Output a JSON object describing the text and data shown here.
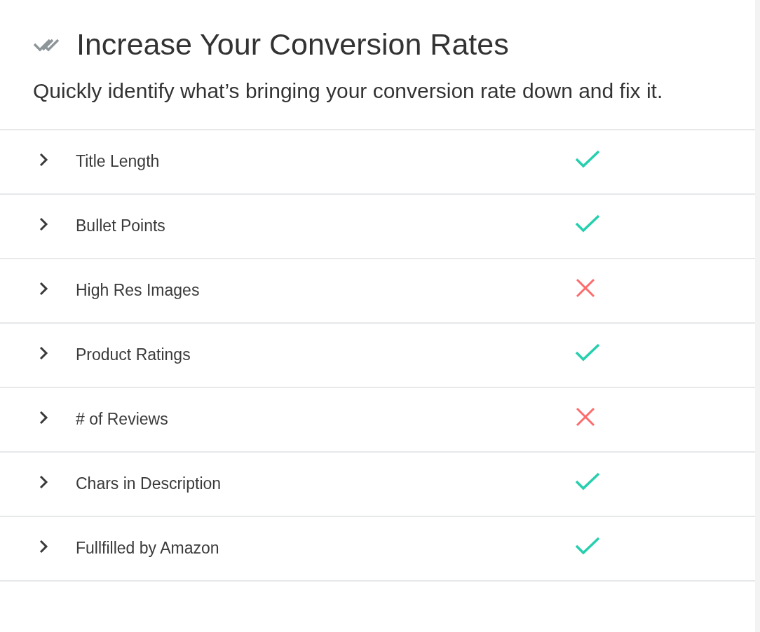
{
  "header": {
    "title": "Increase Your Conversion Rates",
    "subtitle": "Quickly identify what’s bringing your conversion rate down and fix it."
  },
  "checks": [
    {
      "label": "Title Length",
      "expanded": false,
      "passed": true
    },
    {
      "label": "Bullet Points",
      "expanded": false,
      "passed": true
    },
    {
      "label": "High Res Images",
      "expanded": false,
      "passed": false
    },
    {
      "label": "Product Ratings",
      "expanded": false,
      "passed": true
    },
    {
      "label": "# of Reviews",
      "expanded": false,
      "passed": false
    },
    {
      "label": "Chars in Description",
      "expanded": false,
      "passed": true
    },
    {
      "label": "Fullfilled by Amazon",
      "expanded": false,
      "passed": true
    }
  ]
}
